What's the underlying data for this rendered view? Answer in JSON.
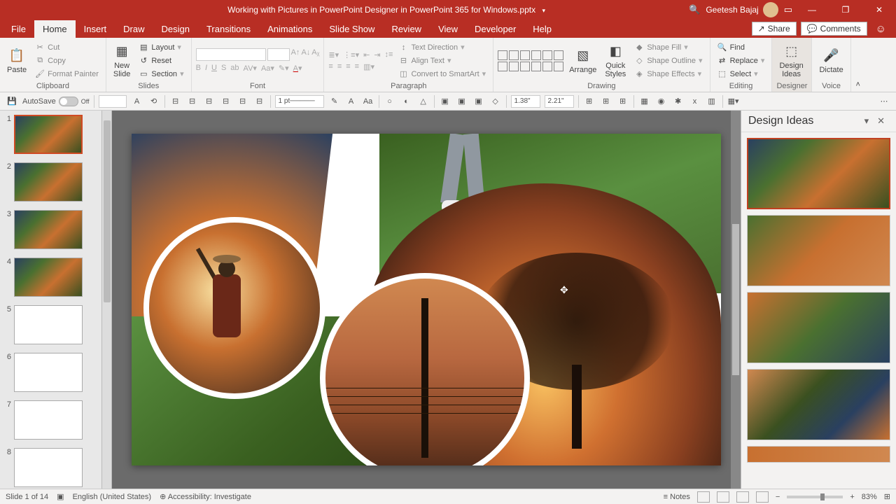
{
  "title": "Working with Pictures in PowerPoint Designer in PowerPoint 365 for Windows.pptx",
  "user": {
    "name": "Geetesh Bajaj"
  },
  "share_label": "Share",
  "comments_label": "Comments",
  "tabs": [
    "File",
    "Home",
    "Insert",
    "Draw",
    "Design",
    "Transitions",
    "Animations",
    "Slide Show",
    "Review",
    "View",
    "Developer",
    "Help"
  ],
  "active_tab": "Home",
  "clipboard": {
    "paste": "Paste",
    "cut": "Cut",
    "copy": "Copy",
    "format_painter": "Format Painter",
    "label": "Clipboard"
  },
  "slides_group": {
    "new_slide": "New\nSlide",
    "layout": "Layout",
    "reset": "Reset",
    "section": "Section",
    "label": "Slides"
  },
  "font_group": {
    "label": "Font"
  },
  "paragraph_group": {
    "text_direction": "Text Direction",
    "align_text": "Align Text",
    "convert_smartart": "Convert to SmartArt",
    "label": "Paragraph"
  },
  "drawing_group": {
    "arrange": "Arrange",
    "quick_styles": "Quick\nStyles",
    "shape_fill": "Shape Fill",
    "shape_outline": "Shape Outline",
    "shape_effects": "Shape Effects",
    "label": "Drawing"
  },
  "editing_group": {
    "find": "Find",
    "replace": "Replace",
    "select": "Select",
    "label": "Editing"
  },
  "designer_group": {
    "design_ideas": "Design\nIdeas",
    "label": "Designer"
  },
  "voice_group": {
    "dictate": "Dictate",
    "label": "Voice"
  },
  "autosave": {
    "label": "AutoSave",
    "state": "Off"
  },
  "qat": {
    "weight": "1 pt",
    "width": "1.38\"",
    "height": "2.21\""
  },
  "thumbnails": {
    "count": 8,
    "slides_type": [
      "collage",
      "collage",
      "collage",
      "collage",
      "blank",
      "blank",
      "blank",
      "blank"
    ],
    "selected": 1
  },
  "design_ideas": {
    "title": "Design Ideas"
  },
  "status": {
    "slide": "Slide 1 of 14",
    "lang": "English (United States)",
    "accessibility": "Accessibility: Investigate",
    "notes": "Notes",
    "zoom": "83%"
  }
}
